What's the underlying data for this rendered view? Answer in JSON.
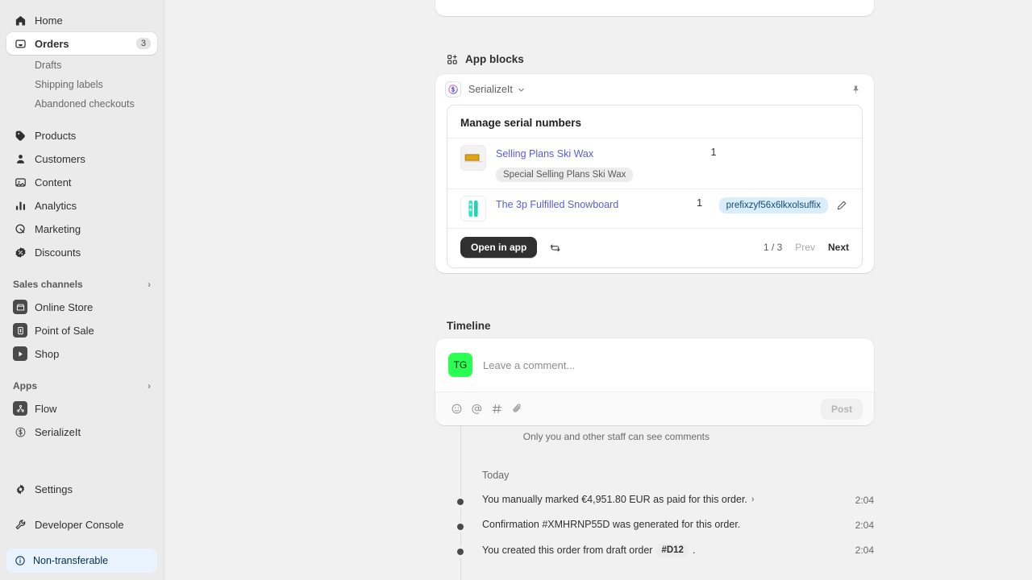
{
  "sidebar": {
    "items": [
      {
        "label": "Home",
        "icon": "home-icon",
        "id": "home"
      },
      {
        "label": "Orders",
        "icon": "orders-icon",
        "id": "orders",
        "badge": "3",
        "active": true
      },
      {
        "label": "Drafts",
        "id": "drafts",
        "sub": true
      },
      {
        "label": "Shipping labels",
        "id": "shipping-labels",
        "sub": true
      },
      {
        "label": "Abandoned checkouts",
        "id": "abandoned-checkouts",
        "sub": true
      },
      {
        "label": "Products",
        "icon": "products-icon",
        "id": "products"
      },
      {
        "label": "Customers",
        "icon": "customers-icon",
        "id": "customers"
      },
      {
        "label": "Content",
        "icon": "content-icon",
        "id": "content"
      },
      {
        "label": "Analytics",
        "icon": "analytics-icon",
        "id": "analytics"
      },
      {
        "label": "Marketing",
        "icon": "marketing-icon",
        "id": "marketing"
      },
      {
        "label": "Discounts",
        "icon": "discounts-icon",
        "id": "discounts"
      }
    ],
    "sales_channels": {
      "label": "Sales channels",
      "chevron": "›"
    },
    "channels": [
      {
        "label": "Online Store",
        "icon": "online-store-icon"
      },
      {
        "label": "Point of Sale",
        "icon": "point-of-sale-icon"
      },
      {
        "label": "Shop",
        "icon": "shop-icon"
      }
    ],
    "apps_header": {
      "label": "Apps",
      "chevron": "›"
    },
    "apps": [
      {
        "label": "Flow",
        "icon": "flow-icon"
      },
      {
        "label": "SerializeIt",
        "icon": "serializeit-icon"
      }
    ],
    "settings": {
      "label": "Settings",
      "icon": "gear-icon"
    },
    "developer_console": {
      "label": "Developer Console",
      "icon": "wrench-icon"
    },
    "non_transferable": {
      "label": "Non-transferable",
      "icon": "info-icon"
    }
  },
  "app_blocks": {
    "section_title": "App blocks",
    "section_icon": "blocks-icon",
    "app_name": "SerializeIt",
    "app_chevron": "⌄",
    "pin_icon": "pin-icon",
    "card_title": "Manage serial numbers",
    "rows": [
      {
        "product": "Selling Plans Ski Wax",
        "variant": "Special Selling Plans Ski Wax",
        "quantity": "1",
        "serial": "",
        "thumb": "ski-wax-thumbnail"
      },
      {
        "product": "The 3p Fulfilled Snowboard",
        "variant": "",
        "quantity": "1",
        "serial": "prefixzyf56x6lkxolsuffix",
        "thumb": "snowboard-thumbnail",
        "edit_icon": "pencil-icon"
      }
    ],
    "open_in_app": "Open in app",
    "refresh_icon": "refresh-icon",
    "page_count": "1 / 3",
    "prev": "Prev",
    "next": "Next"
  },
  "timeline": {
    "title": "Timeline",
    "avatar_initials": "TG",
    "comment_placeholder": "Leave a comment...",
    "toolbar_icons": [
      "emoji-icon",
      "mention-icon",
      "hashtag-icon",
      "attachment-icon"
    ],
    "post_label": "Post",
    "visibility_note": "Only you and other staff can see comments",
    "day_label": "Today",
    "events": [
      {
        "text": "You manually marked €4,951.80 EUR as paid for this order.",
        "chevron": "›",
        "time": "2:04"
      },
      {
        "text": "Confirmation #XMHRNP55D was generated for this order.",
        "time": "2:04"
      },
      {
        "text_before": "You created this order from draft order",
        "chip": "#D12",
        "text_after": ".",
        "time": "2:04"
      }
    ]
  },
  "colors": {
    "sidebar_bg": "#ebebeb",
    "content_bg": "#f1f1f1",
    "link": "#5a5ce0",
    "serial_badge_bg": "#d9edfd",
    "avatar_green": "#2afe52",
    "accent_dark": "#303030",
    "info_pill_bg": "#eaf4fe"
  }
}
